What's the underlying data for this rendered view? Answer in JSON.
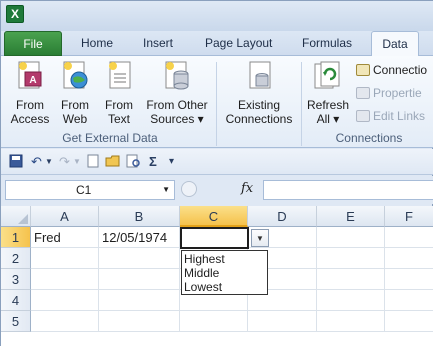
{
  "tabs": {
    "file": "File",
    "home": "Home",
    "insert": "Insert",
    "page_layout": "Page Layout",
    "formulas": "Formulas",
    "data": "Data"
  },
  "ribbon": {
    "from_access": [
      "From",
      "Access"
    ],
    "from_web": [
      "From",
      "Web"
    ],
    "from_text": [
      "From",
      "Text"
    ],
    "from_other": [
      "From Other",
      "Sources ▾"
    ],
    "existing": [
      "Existing",
      "Connections"
    ],
    "refresh": [
      "Refresh",
      "All ▾"
    ],
    "group_external": "Get External Data",
    "group_connections": "Connections",
    "connections": "Connectio",
    "properties": "Propertie",
    "edit_links": "Edit Links"
  },
  "qat": {
    "undo": "↶",
    "redo": "↷",
    "sum": "Σ",
    "more": "▾"
  },
  "formula_bar": {
    "name_box": "C1",
    "fx": "fx",
    "value": ""
  },
  "sheet": {
    "columns": [
      "A",
      "B",
      "C",
      "D",
      "E",
      "F"
    ],
    "rows": [
      "1",
      "2",
      "3",
      "4",
      "5"
    ],
    "cells": {
      "A1": "Fred",
      "B1": "12/05/1974"
    }
  },
  "dropdown": {
    "options": [
      "Highest",
      "Middle",
      "Lowest"
    ]
  },
  "colors": {
    "accent_green": "#2a7e34",
    "selection": "#f5c24c"
  }
}
